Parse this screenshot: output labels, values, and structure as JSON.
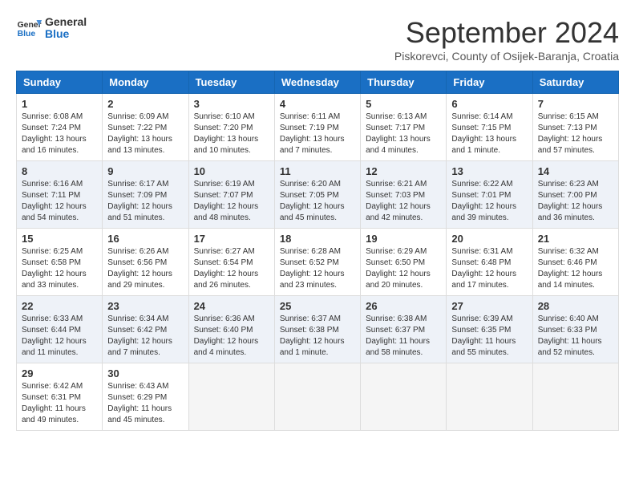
{
  "header": {
    "logo_line1": "General",
    "logo_line2": "Blue",
    "month_year": "September 2024",
    "location": "Piskorevci, County of Osijek-Baranja, Croatia"
  },
  "weekdays": [
    "Sunday",
    "Monday",
    "Tuesday",
    "Wednesday",
    "Thursday",
    "Friday",
    "Saturday"
  ],
  "weeks": [
    [
      {
        "day": "1",
        "info": "Sunrise: 6:08 AM\nSunset: 7:24 PM\nDaylight: 13 hours\nand 16 minutes."
      },
      {
        "day": "2",
        "info": "Sunrise: 6:09 AM\nSunset: 7:22 PM\nDaylight: 13 hours\nand 13 minutes."
      },
      {
        "day": "3",
        "info": "Sunrise: 6:10 AM\nSunset: 7:20 PM\nDaylight: 13 hours\nand 10 minutes."
      },
      {
        "day": "4",
        "info": "Sunrise: 6:11 AM\nSunset: 7:19 PM\nDaylight: 13 hours\nand 7 minutes."
      },
      {
        "day": "5",
        "info": "Sunrise: 6:13 AM\nSunset: 7:17 PM\nDaylight: 13 hours\nand 4 minutes."
      },
      {
        "day": "6",
        "info": "Sunrise: 6:14 AM\nSunset: 7:15 PM\nDaylight: 13 hours\nand 1 minute."
      },
      {
        "day": "7",
        "info": "Sunrise: 6:15 AM\nSunset: 7:13 PM\nDaylight: 12 hours\nand 57 minutes."
      }
    ],
    [
      {
        "day": "8",
        "info": "Sunrise: 6:16 AM\nSunset: 7:11 PM\nDaylight: 12 hours\nand 54 minutes."
      },
      {
        "day": "9",
        "info": "Sunrise: 6:17 AM\nSunset: 7:09 PM\nDaylight: 12 hours\nand 51 minutes."
      },
      {
        "day": "10",
        "info": "Sunrise: 6:19 AM\nSunset: 7:07 PM\nDaylight: 12 hours\nand 48 minutes."
      },
      {
        "day": "11",
        "info": "Sunrise: 6:20 AM\nSunset: 7:05 PM\nDaylight: 12 hours\nand 45 minutes."
      },
      {
        "day": "12",
        "info": "Sunrise: 6:21 AM\nSunset: 7:03 PM\nDaylight: 12 hours\nand 42 minutes."
      },
      {
        "day": "13",
        "info": "Sunrise: 6:22 AM\nSunset: 7:01 PM\nDaylight: 12 hours\nand 39 minutes."
      },
      {
        "day": "14",
        "info": "Sunrise: 6:23 AM\nSunset: 7:00 PM\nDaylight: 12 hours\nand 36 minutes."
      }
    ],
    [
      {
        "day": "15",
        "info": "Sunrise: 6:25 AM\nSunset: 6:58 PM\nDaylight: 12 hours\nand 33 minutes."
      },
      {
        "day": "16",
        "info": "Sunrise: 6:26 AM\nSunset: 6:56 PM\nDaylight: 12 hours\nand 29 minutes."
      },
      {
        "day": "17",
        "info": "Sunrise: 6:27 AM\nSunset: 6:54 PM\nDaylight: 12 hours\nand 26 minutes."
      },
      {
        "day": "18",
        "info": "Sunrise: 6:28 AM\nSunset: 6:52 PM\nDaylight: 12 hours\nand 23 minutes."
      },
      {
        "day": "19",
        "info": "Sunrise: 6:29 AM\nSunset: 6:50 PM\nDaylight: 12 hours\nand 20 minutes."
      },
      {
        "day": "20",
        "info": "Sunrise: 6:31 AM\nSunset: 6:48 PM\nDaylight: 12 hours\nand 17 minutes."
      },
      {
        "day": "21",
        "info": "Sunrise: 6:32 AM\nSunset: 6:46 PM\nDaylight: 12 hours\nand 14 minutes."
      }
    ],
    [
      {
        "day": "22",
        "info": "Sunrise: 6:33 AM\nSunset: 6:44 PM\nDaylight: 12 hours\nand 11 minutes."
      },
      {
        "day": "23",
        "info": "Sunrise: 6:34 AM\nSunset: 6:42 PM\nDaylight: 12 hours\nand 7 minutes."
      },
      {
        "day": "24",
        "info": "Sunrise: 6:36 AM\nSunset: 6:40 PM\nDaylight: 12 hours\nand 4 minutes."
      },
      {
        "day": "25",
        "info": "Sunrise: 6:37 AM\nSunset: 6:38 PM\nDaylight: 12 hours\nand 1 minute."
      },
      {
        "day": "26",
        "info": "Sunrise: 6:38 AM\nSunset: 6:37 PM\nDaylight: 11 hours\nand 58 minutes."
      },
      {
        "day": "27",
        "info": "Sunrise: 6:39 AM\nSunset: 6:35 PM\nDaylight: 11 hours\nand 55 minutes."
      },
      {
        "day": "28",
        "info": "Sunrise: 6:40 AM\nSunset: 6:33 PM\nDaylight: 11 hours\nand 52 minutes."
      }
    ],
    [
      {
        "day": "29",
        "info": "Sunrise: 6:42 AM\nSunset: 6:31 PM\nDaylight: 11 hours\nand 49 minutes."
      },
      {
        "day": "30",
        "info": "Sunrise: 6:43 AM\nSunset: 6:29 PM\nDaylight: 11 hours\nand 45 minutes."
      },
      {
        "day": "",
        "info": ""
      },
      {
        "day": "",
        "info": ""
      },
      {
        "day": "",
        "info": ""
      },
      {
        "day": "",
        "info": ""
      },
      {
        "day": "",
        "info": ""
      }
    ]
  ]
}
